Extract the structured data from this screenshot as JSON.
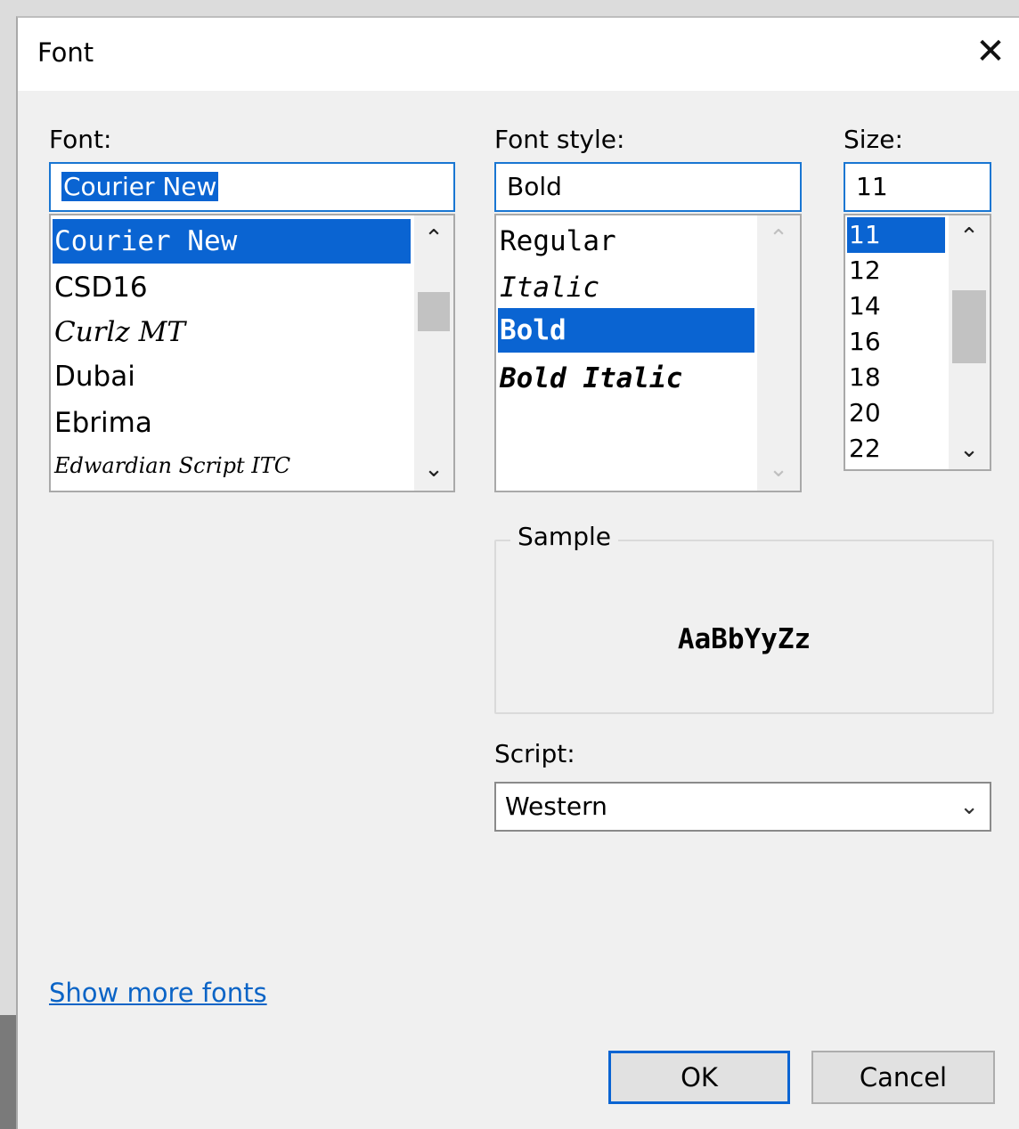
{
  "dialog": {
    "title": "Font",
    "close_glyph": "✕"
  },
  "font": {
    "label": "Font:",
    "value": "Courier New",
    "items": [
      "Courier New",
      "CSD16",
      "Curlz MT",
      "Dubai",
      "Ebrima",
      "Edwardian Script ITC"
    ],
    "selected": "Courier New"
  },
  "style": {
    "label": "Font style:",
    "value": "Bold",
    "items": [
      "Regular",
      "Italic",
      "Bold",
      "Bold Italic"
    ],
    "selected": "Bold"
  },
  "size": {
    "label": "Size:",
    "value": "11",
    "items": [
      "11",
      "12",
      "14",
      "16",
      "18",
      "20",
      "22"
    ],
    "selected": "11"
  },
  "sample": {
    "label": "Sample",
    "text": "AaBbYyZz"
  },
  "script": {
    "label": "Script:",
    "value": "Western"
  },
  "link": {
    "show_more": "Show more fonts"
  },
  "buttons": {
    "ok": "OK",
    "cancel": "Cancel"
  },
  "icons": {
    "close": "close-icon",
    "scroll_up": "chevron-up-icon",
    "scroll_down": "chevron-down-icon",
    "dropdown": "chevron-down-icon"
  },
  "colors": {
    "selection": "#0a64d2",
    "focus_border": "#1976d2",
    "link": "#0b64c6"
  }
}
